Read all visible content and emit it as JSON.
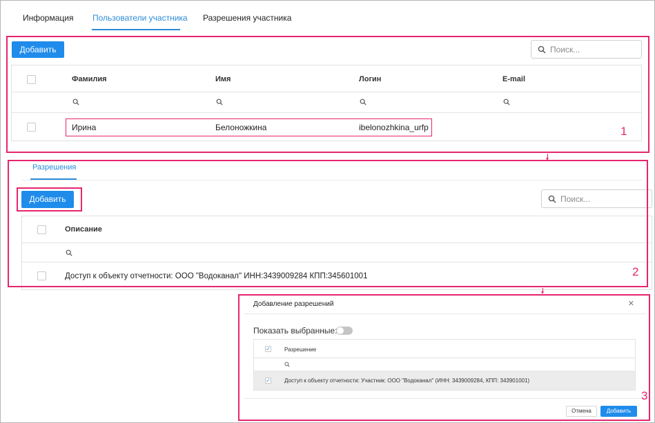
{
  "tabs": [
    {
      "label": "Информация",
      "active": false
    },
    {
      "label": "Пользователи участника",
      "active": true
    },
    {
      "label": "Разрешения участника",
      "active": false
    }
  ],
  "users": {
    "add_label": "Добавить",
    "search_placeholder": "Поиск...",
    "columns": [
      "Фамилия",
      "Имя",
      "Логин",
      "E-mail"
    ],
    "rows": [
      {
        "last_name": "Ирина",
        "first_name": "Белоножкина",
        "login": "ibelonozhkina_urfp",
        "email": ""
      }
    ]
  },
  "permissions": {
    "tab_label": "Разрешения",
    "add_label": "Добавить",
    "search_placeholder": "Поиск...",
    "columns": [
      "Описание"
    ],
    "rows": [
      {
        "description": "Доступ к объекту отчетности: ООО \"Водоканал\" ИНН:3439009284 КПП:345601001"
      }
    ]
  },
  "dialog": {
    "title": "Добавление разрешений",
    "close_icon": "close-icon",
    "show_selected_label": "Показать выбранные:",
    "show_selected_on": false,
    "column": "Разрешение",
    "rows": [
      {
        "text": "Доступ к объекту отчетности: Участник: ООО \"Водоканал\" (ИНН: 3439009284, КПП: 343901001)",
        "checked": true
      }
    ],
    "header_checked": true,
    "cancel_label": "Отмена",
    "add_label": "Добавить"
  },
  "annotations": [
    "1",
    "2",
    "3"
  ],
  "colors": {
    "accent": "#1f8ceb",
    "annotation": "#e6246e"
  }
}
